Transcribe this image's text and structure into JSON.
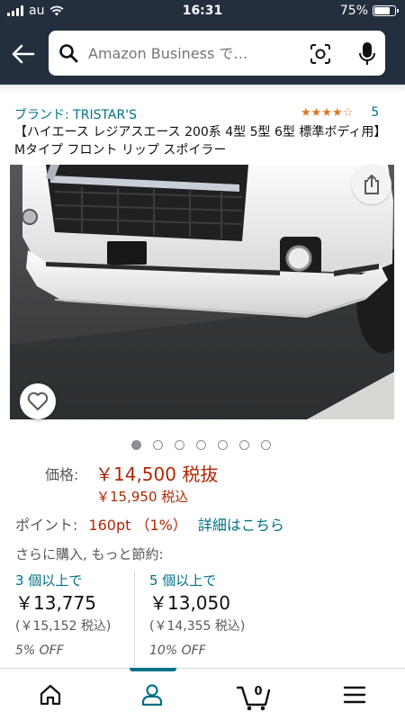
{
  "status_bar": {
    "carrier": "au",
    "time": "16:31",
    "battery": "75%",
    "battery_level": 0.75
  },
  "header": {
    "search_placeholder": "Amazon Business で…",
    "bg_color": "#232f3e"
  },
  "product": {
    "brand": "ブランド: TRISTAR'S",
    "rating_stars": 4,
    "rating_count": "5",
    "title": "【ハイエース レジアスエース 200系 4型 5型 6型 標準ボディ用】Mタイプ フロント リップ スポイラー",
    "image_count": 7,
    "active_image": 1
  },
  "price": {
    "label": "価格:",
    "main": "￥14,500 税抜",
    "tax_included": "￥15,950 税込",
    "points_label": "ポイント:",
    "points_value": "160pt （1%）",
    "points_link": "詳細はこちら"
  },
  "bulk": {
    "heading": "さらに購入, もっと節約:",
    "tiers": [
      {
        "qty": "3 個以上で",
        "price": "￥13,775",
        "tax": "(￥15,152 税込)",
        "off": "5% OFF"
      },
      {
        "qty": "5 個以上で",
        "price": "￥13,050",
        "tax": "(￥14,355 税込)",
        "off": "10% OFF"
      }
    ]
  },
  "bottom_nav": {
    "cart_count": "0",
    "active": "account"
  },
  "colors": {
    "link": "#007185",
    "price": "#b12704",
    "star": "#de7921"
  }
}
